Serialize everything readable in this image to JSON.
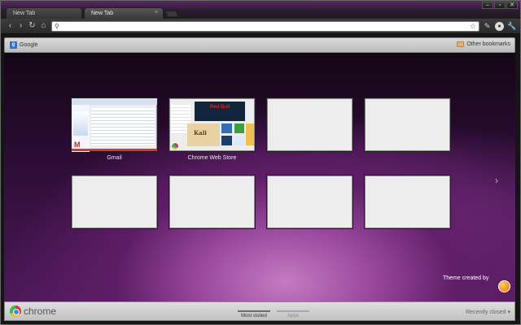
{
  "tabs": [
    {
      "title": "New Tab",
      "active": false
    },
    {
      "title": "New Tab",
      "active": true
    }
  ],
  "tab_close_glyph": "×",
  "window_controls": [
    "–",
    "▫",
    "✕"
  ],
  "toolbar": {
    "back": "‹",
    "forward": "›",
    "reload": "↻",
    "home": "⌂",
    "omnibox_value": "",
    "omnibox_placeholder": "",
    "star": "☆",
    "page_action": "✎",
    "wrench": "✔"
  },
  "bookmarks": {
    "items": [
      {
        "label": "Google",
        "favicon_letter": "g"
      }
    ],
    "other": "Other bookmarks"
  },
  "most_visited": [
    {
      "label": "Gmail",
      "filled": true
    },
    {
      "label": "Chrome Web Store",
      "filled": true
    },
    {
      "label": "",
      "filled": false
    },
    {
      "label": "",
      "filled": false
    },
    {
      "label": "",
      "filled": false
    },
    {
      "label": "",
      "filled": false
    },
    {
      "label": "",
      "filled": false
    },
    {
      "label": "",
      "filled": false
    }
  ],
  "gmail_logo_text": "M",
  "webstore_text": {
    "brand": "Red Bull",
    "game": "Kali"
  },
  "next_arrow": "›",
  "theme_credit": "Theme created by",
  "footer": {
    "brand": "chrome",
    "sections": [
      "Most visited",
      "Apps"
    ],
    "recently_closed": "Recently closed ▾"
  },
  "colors": {
    "theme_purple": "#9b4a9e",
    "gmail_red": "#d0211f"
  }
}
